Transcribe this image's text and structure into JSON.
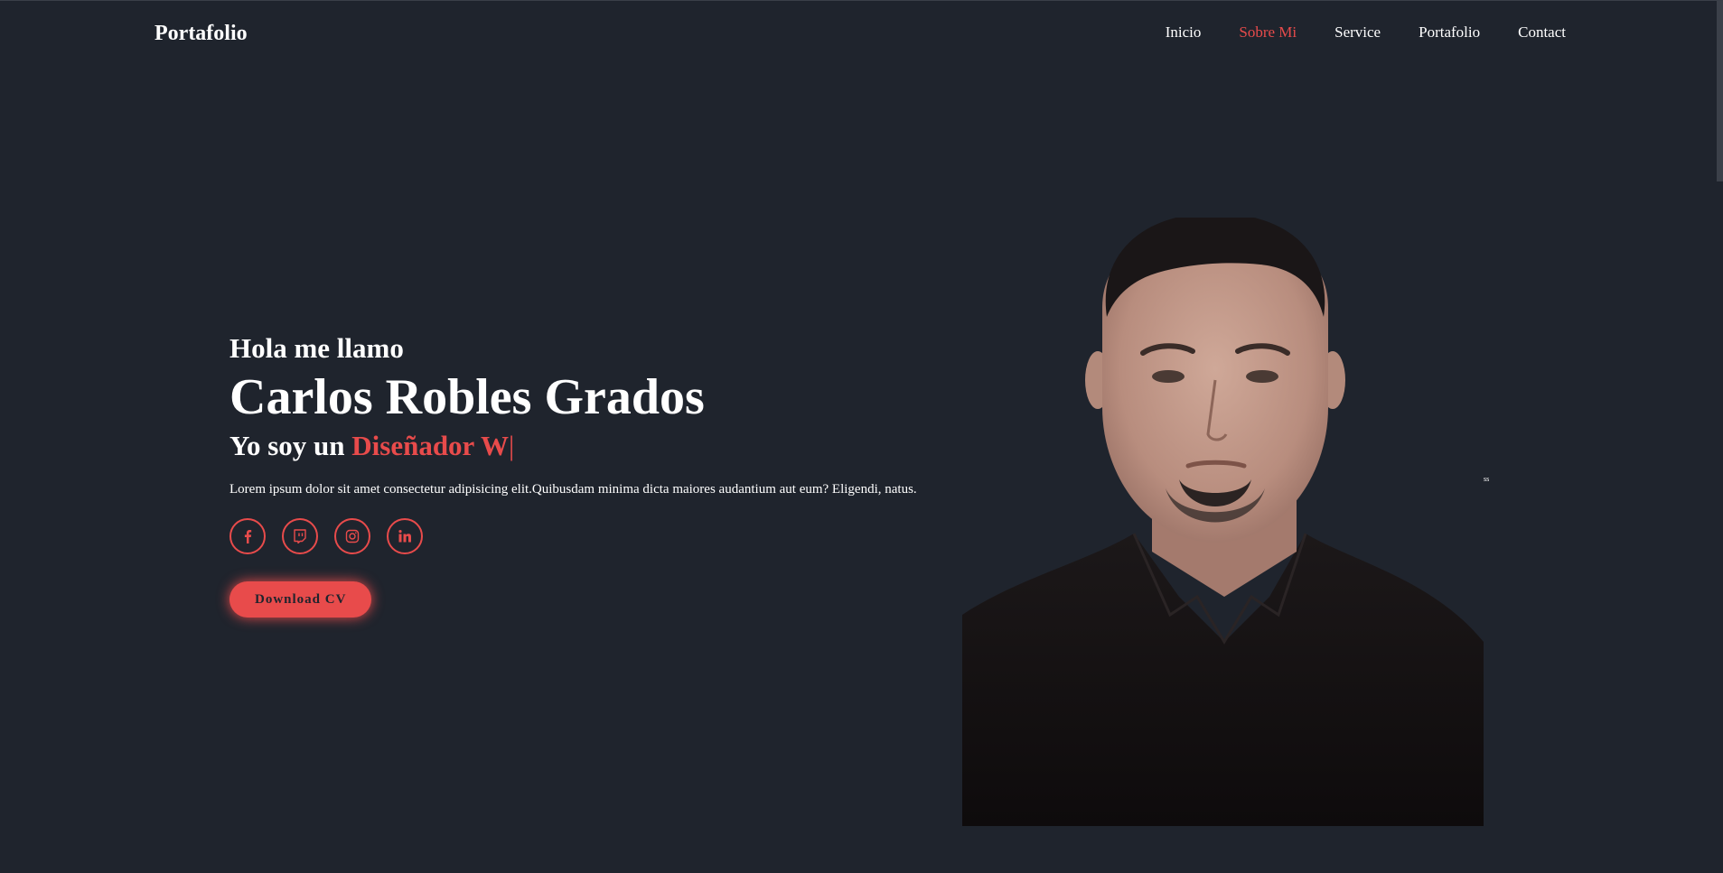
{
  "header": {
    "logo": "Portafolio",
    "nav": [
      {
        "label": "Inicio",
        "active": false
      },
      {
        "label": "Sobre Mi",
        "active": true
      },
      {
        "label": "Service",
        "active": false
      },
      {
        "label": "Portafolio",
        "active": false
      },
      {
        "label": "Contact",
        "active": false
      }
    ]
  },
  "home": {
    "greeting": "Hola me llamo",
    "name": "Carlos Robles Grados",
    "role_prefix": "Yo soy un",
    "role_highlight": "Diseñador W",
    "role_cursor": "|",
    "description": "Lorem ipsum dolor sit amet consectetur adipisicing elit.Quibusdam minima dicta maiores audantium aut eum? Eligendi, natus.",
    "socials": [
      {
        "icon": "facebook-icon"
      },
      {
        "icon": "twitch-icon"
      },
      {
        "icon": "instagram-icon"
      },
      {
        "icon": "linkedin-icon"
      }
    ],
    "download_label": "Download CV",
    "side_text": "ss"
  },
  "colors": {
    "background": "#1f242d",
    "accent": "#e84b4b",
    "text": "#ffffff"
  }
}
